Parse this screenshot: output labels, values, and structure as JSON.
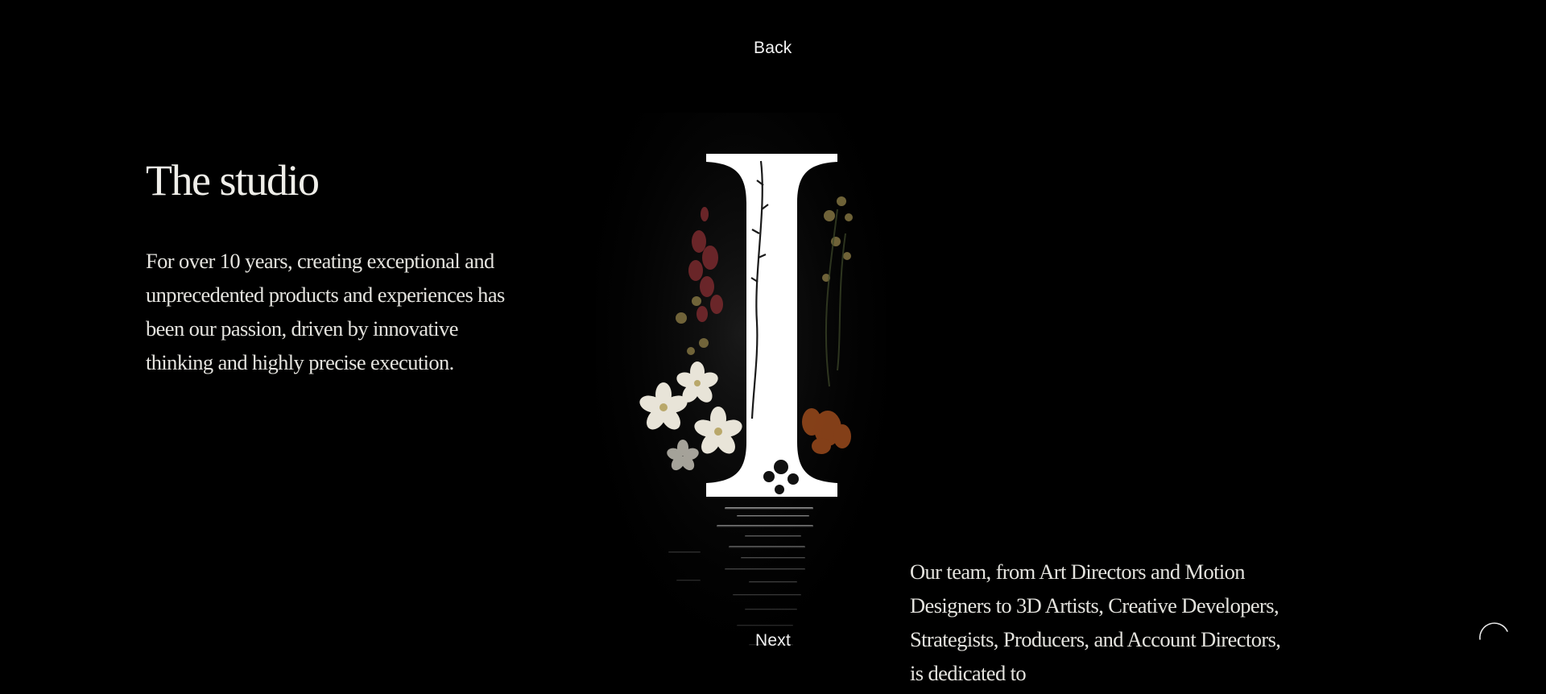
{
  "nav": {
    "back_label": "Back",
    "next_label": "Next"
  },
  "hero": {
    "title": "The studio",
    "intro": "For over 10 years, creating exceptional and unprecedented products and experiences has been our passion, driven by innovative thinking and highly precise execution.",
    "team": "Our team, from Art Directors and Motion Designers to 3D Artists, Creative Developers, Strategists, Producers, and Account Directors, is dedicated to",
    "artwork_letter": "I"
  },
  "colors": {
    "background": "#000000",
    "text": "#ecebe6",
    "letter": "#ffffff",
    "flower_red": "#7a2a2e",
    "flower_white": "#e8e4d8",
    "flower_olive": "#8a7a45",
    "flower_orange": "#9a4a1c"
  },
  "icons": {
    "loader": "loading-arc-icon"
  }
}
